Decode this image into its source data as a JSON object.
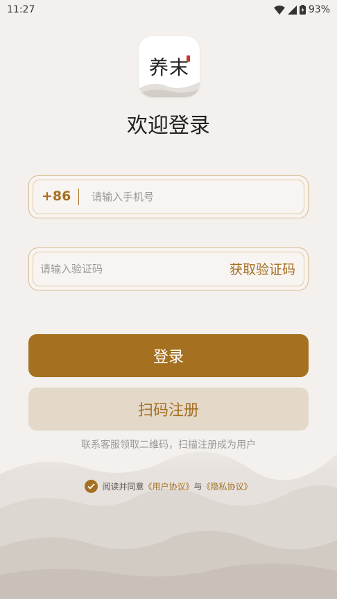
{
  "status_bar": {
    "time": "11:27",
    "battery": "93%",
    "icons": [
      "wifi-icon",
      "signal-icon",
      "battery-icon"
    ]
  },
  "app": {
    "logo_text": "养末"
  },
  "page": {
    "title": "欢迎登录"
  },
  "phone_field": {
    "prefix": "+86",
    "placeholder": "请输入手机号",
    "value": ""
  },
  "code_field": {
    "placeholder": "请输入验证码",
    "value": "",
    "get_code_label": "获取验证码"
  },
  "buttons": {
    "login_label": "登录",
    "register_label": "扫码注册"
  },
  "hint": "联系客服领取二维码，扫描注册成为用户",
  "agreement": {
    "checked": true,
    "prefix": "阅读并同意",
    "user_agreement": "《用户协议》",
    "and": "与",
    "privacy_agreement": "《隐私协议》"
  },
  "colors": {
    "accent": "#a5701f",
    "background": "#f3f0ed",
    "secondary_button": "#e4d8c8"
  }
}
